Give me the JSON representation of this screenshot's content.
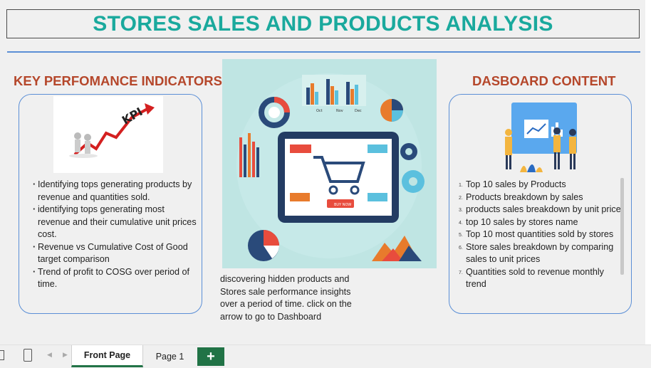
{
  "title": "STORES SALES AND PRODUCTS ANALYSIS",
  "kpi": {
    "heading": "KEY PERFOMANCE INDICATORS",
    "image_text": "KPI",
    "items": [
      "Identifying tops generating products by revenue and quantities sold.",
      "identifying tops generating most revenue and their cumulative unit prices cost.",
      "Revenue vs Cumulative Cost of Good target comparison",
      "Trend of profit to COSG over period of time."
    ]
  },
  "hero": {
    "chart_labels": [
      "Oct",
      "Nov",
      "Dec"
    ],
    "buy_label": "BUY NOW",
    "description": "discovering hidden products and Stores sale performance insights over a period of time. click on the arrow to go to Dashboard"
  },
  "dashboard": {
    "heading": "DASBOARD CONTENT",
    "items": [
      {
        "num": "1.",
        "text": "Top 10  sales by Products"
      },
      {
        "num": "2.",
        "text": "Products breakdown by sales"
      },
      {
        "num": "3.",
        "text": "products sales breakdown by unit price"
      },
      {
        "num": "4.",
        "text": "top 10 sales by stores name"
      },
      {
        "num": "5.",
        "text": "Top 10 most quantities sold by stores"
      },
      {
        "num": "6.",
        "text": "Store sales breakdown by comparing sales to unit prices"
      },
      {
        "num": "7.",
        "text": "Quantities sold to revenue  monthly trend"
      }
    ]
  },
  "tabs": {
    "sheets": [
      "Front Page",
      "Page 1"
    ],
    "add": "+"
  },
  "colors": {
    "title": "#1aa99d",
    "heading": "#b5472b",
    "border": "#5b8fd6",
    "excel_green": "#217346"
  }
}
